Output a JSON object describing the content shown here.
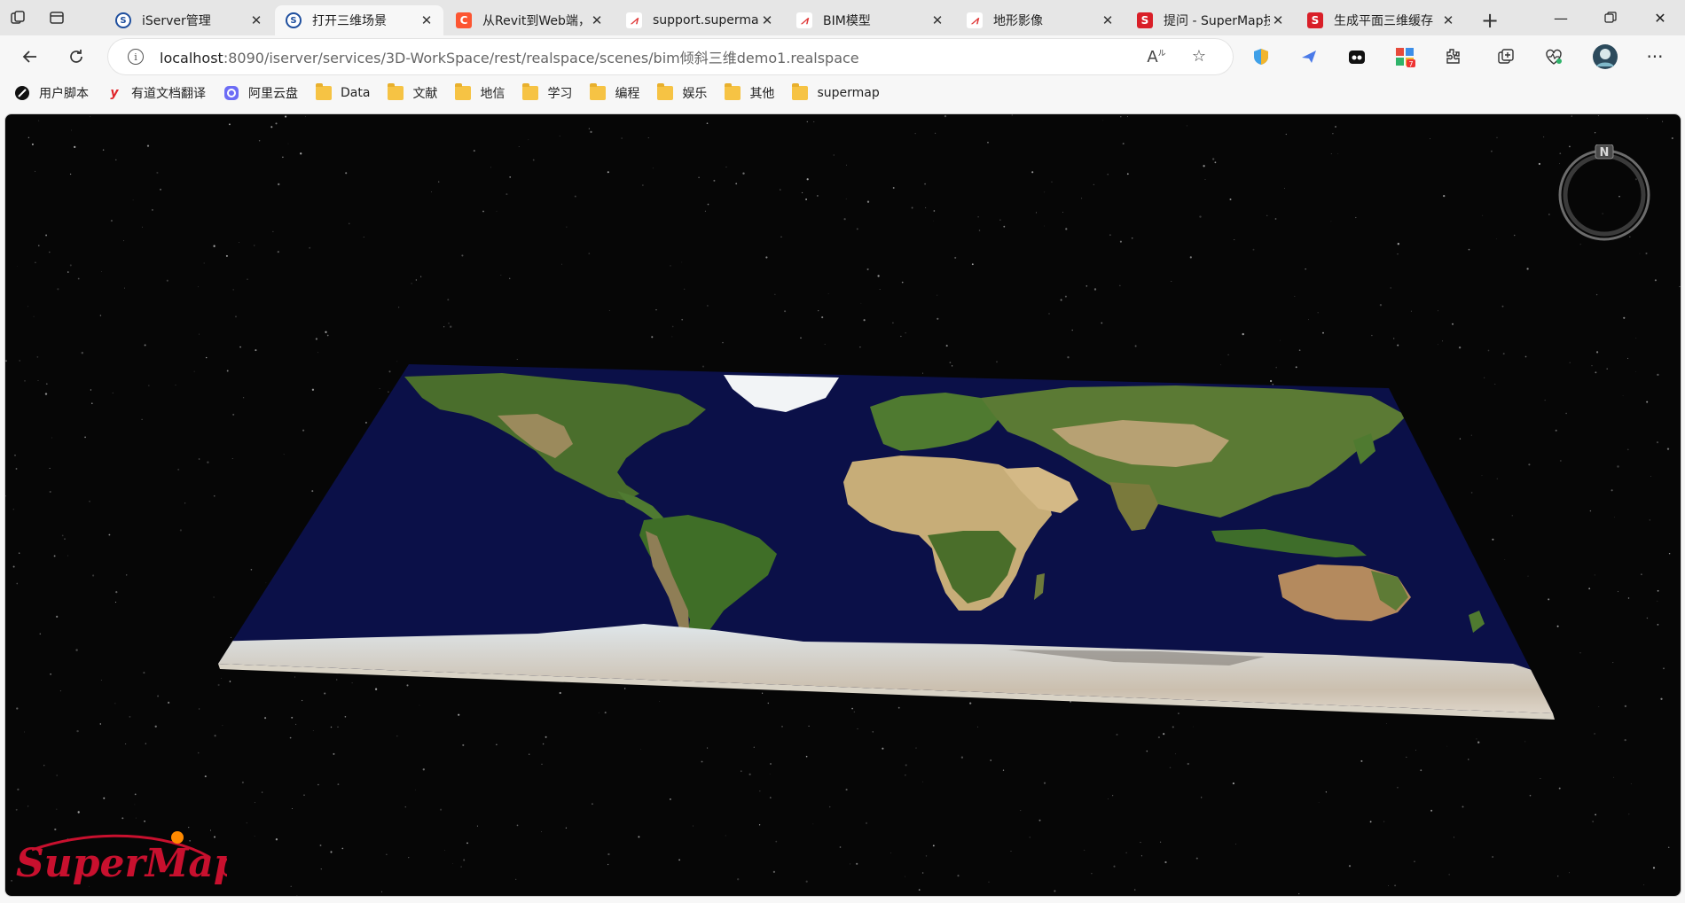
{
  "tabs": [
    {
      "title": "iServer管理",
      "icon": "iserver-icon",
      "kind": "iserver",
      "active": false
    },
    {
      "title": "打开三维场景",
      "icon": "iserver-icon",
      "kind": "iserver",
      "active": true
    },
    {
      "title": "从Revit到Web端，",
      "icon": "csdn-icon",
      "kind": "csdn",
      "active": false
    },
    {
      "title": "support.supermap",
      "icon": "supermap-icon",
      "kind": "sm",
      "active": false
    },
    {
      "title": "BIM模型",
      "icon": "supermap-icon",
      "kind": "sm",
      "active": false
    },
    {
      "title": "地形影像",
      "icon": "supermap-icon",
      "kind": "sm",
      "active": false
    },
    {
      "title": "提问 - SuperMap技",
      "icon": "supermap-s-icon",
      "kind": "s-red",
      "active": false
    },
    {
      "title": "生成平面三维缓存",
      "icon": "supermap-s-icon",
      "kind": "s-red",
      "active": false
    }
  ],
  "address": {
    "host": "localhost",
    "rest": ":8090/iserver/services/3D-WorkSpace/rest/realspace/scenes/bim倾斜三维demo1.realspace"
  },
  "bookmarks": [
    {
      "label": "用户脚本",
      "icon": "userscript-icon",
      "type": "site"
    },
    {
      "label": "有道文档翻译",
      "icon": "youdao-icon",
      "type": "site"
    },
    {
      "label": "阿里云盘",
      "icon": "aliyun-drive-icon",
      "type": "site"
    },
    {
      "label": "Data",
      "icon": "folder-icon",
      "type": "folder"
    },
    {
      "label": "文献",
      "icon": "folder-icon",
      "type": "folder"
    },
    {
      "label": "地信",
      "icon": "folder-icon",
      "type": "folder"
    },
    {
      "label": "学习",
      "icon": "folder-icon",
      "type": "folder"
    },
    {
      "label": "编程",
      "icon": "folder-icon",
      "type": "folder"
    },
    {
      "label": "娱乐",
      "icon": "folder-icon",
      "type": "folder"
    },
    {
      "label": "其他",
      "icon": "folder-icon",
      "type": "folder"
    },
    {
      "label": "supermap",
      "icon": "folder-icon",
      "type": "folder"
    }
  ],
  "scene": {
    "compass_label": "N",
    "logo_text": "SuperMap",
    "background": "#060606",
    "ocean_color": "#0b1048"
  },
  "colors": {
    "tabstrip": "#e6e6e6",
    "active_tab": "#f7f7f7",
    "folder": "#f6c344",
    "logo_red": "#c8102e",
    "logo_dot": "#ff8a00"
  }
}
